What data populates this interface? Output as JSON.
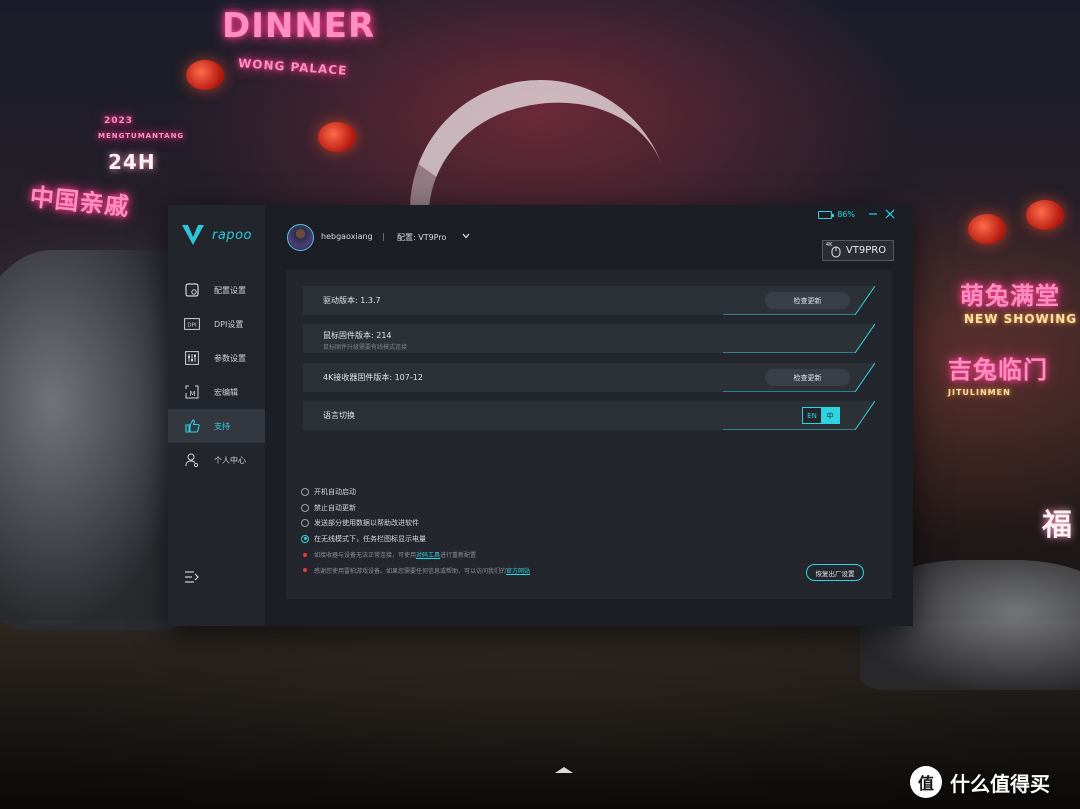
{
  "app": {
    "brand": "rapoo"
  },
  "window": {
    "battery": "86%",
    "battery_level": 0.86,
    "close_icon": "close-icon",
    "minimize_icon": "minimize-icon"
  },
  "sidebar": {
    "items": [
      {
        "label": "配置设置",
        "icon": "config-icon",
        "active": false
      },
      {
        "label": "DPI设置",
        "icon": "dpi-icon",
        "active": false
      },
      {
        "label": "参数设置",
        "icon": "sliders-icon",
        "active": false
      },
      {
        "label": "宏编辑",
        "icon": "macro-icon",
        "active": false
      },
      {
        "label": "支持",
        "icon": "thumbs-up-icon",
        "active": true
      },
      {
        "label": "个人中心",
        "icon": "user-icon",
        "active": false
      }
    ],
    "collapse_icon": "collapse-menu-icon"
  },
  "header": {
    "username": "hebgaoxiang",
    "separator": "|",
    "profile": "配置: VT9Pro",
    "device": "VT9PRO",
    "device_tag": "4K"
  },
  "support": {
    "rows": [
      {
        "label": "驱动版本: 1.3.7",
        "button": "检查更新"
      },
      {
        "label": "鼠标固件版本: 214",
        "sub": "鼠标固件升级需要有线模式连接"
      },
      {
        "label": "4K接收器固件版本: 107-12",
        "button": "检查更新"
      },
      {
        "label": "语言切换",
        "lang_en": "EN",
        "lang_zh": "中",
        "selected": "中"
      }
    ],
    "options": [
      {
        "label": "开机自动启动",
        "checked": false
      },
      {
        "label": "禁止自动更新",
        "checked": false
      },
      {
        "label": "发送部分使用数据以帮助改进软件",
        "checked": false
      },
      {
        "label": "在无线模式下，任务栏图标显示电量",
        "checked": true
      }
    ],
    "notes": [
      {
        "before": "如接收器与设备无法正常连接，可使用",
        "link": "对码工具",
        "after": "进行重新配置"
      },
      {
        "before": "感谢您使用雷柏游戏设备。如果您需要任何信息或帮助，可以访问我们的",
        "link": "官方网站",
        "after": ""
      }
    ],
    "reset_button": "恢复出厂设置"
  },
  "background": {
    "signs": [
      "DINNER",
      "WONG PALACE",
      "24H",
      "2023",
      "MENGTUMANTANG",
      "中国亲戚",
      "萌兔满堂",
      "NEW SHOWING",
      "吉兔临门",
      "JITULINMEN",
      "福"
    ]
  },
  "watermark": {
    "text": "什么值得买",
    "icon": "值"
  },
  "colors": {
    "accent": "#2fd3e0",
    "window_bg": "#1c1f26",
    "sidebar_bg": "#22252c",
    "panel_bg": "#23262d",
    "alert": "#e03a3a"
  }
}
